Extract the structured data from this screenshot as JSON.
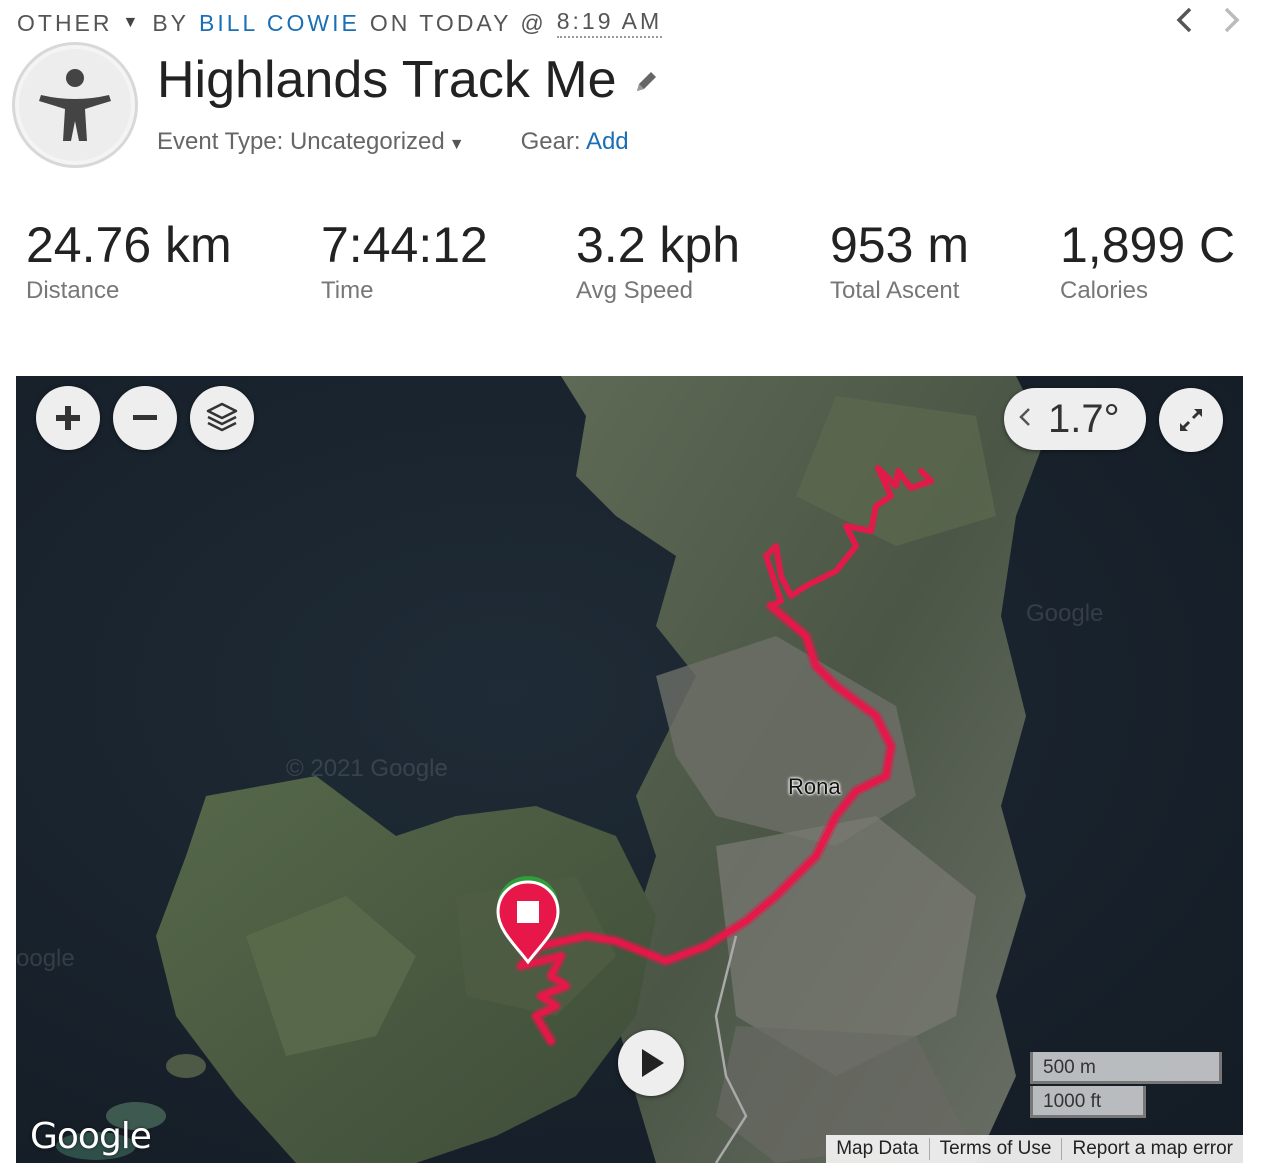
{
  "header": {
    "activity_type": "OTHER",
    "by_label": "BY",
    "athlete_name": "BILL COWIE",
    "on_label": "ON TODAY @",
    "time": "8:19 AM"
  },
  "activity": {
    "title": "Highlands Track Me",
    "event_type": "Event Type: Uncategorized",
    "gear_label": "Gear:",
    "gear_link": "Add"
  },
  "stats": [
    {
      "value": "24.76 km",
      "label": "Distance"
    },
    {
      "value": "7:44:12",
      "label": "Time"
    },
    {
      "value": "3.2 kph",
      "label": "Avg Speed"
    },
    {
      "value": "953 m",
      "label": "Total Ascent"
    },
    {
      "value": "1,899 C",
      "label": "Calories"
    }
  ],
  "map": {
    "rotation": "1.7°",
    "place_label": "Rona",
    "scale_metric": "500 m",
    "scale_imperial": "1000 ft",
    "logo": "Google",
    "attribution": [
      "Map Data",
      "Terms of Use",
      "Report a map error"
    ],
    "track_color": "#e8174a",
    "controls": [
      "zoom-in-icon",
      "zoom-out-icon",
      "layers-icon",
      "fullscreen-icon",
      "play-icon"
    ]
  },
  "colors": {
    "link": "#1a6fb5",
    "track": "#e8174a"
  }
}
